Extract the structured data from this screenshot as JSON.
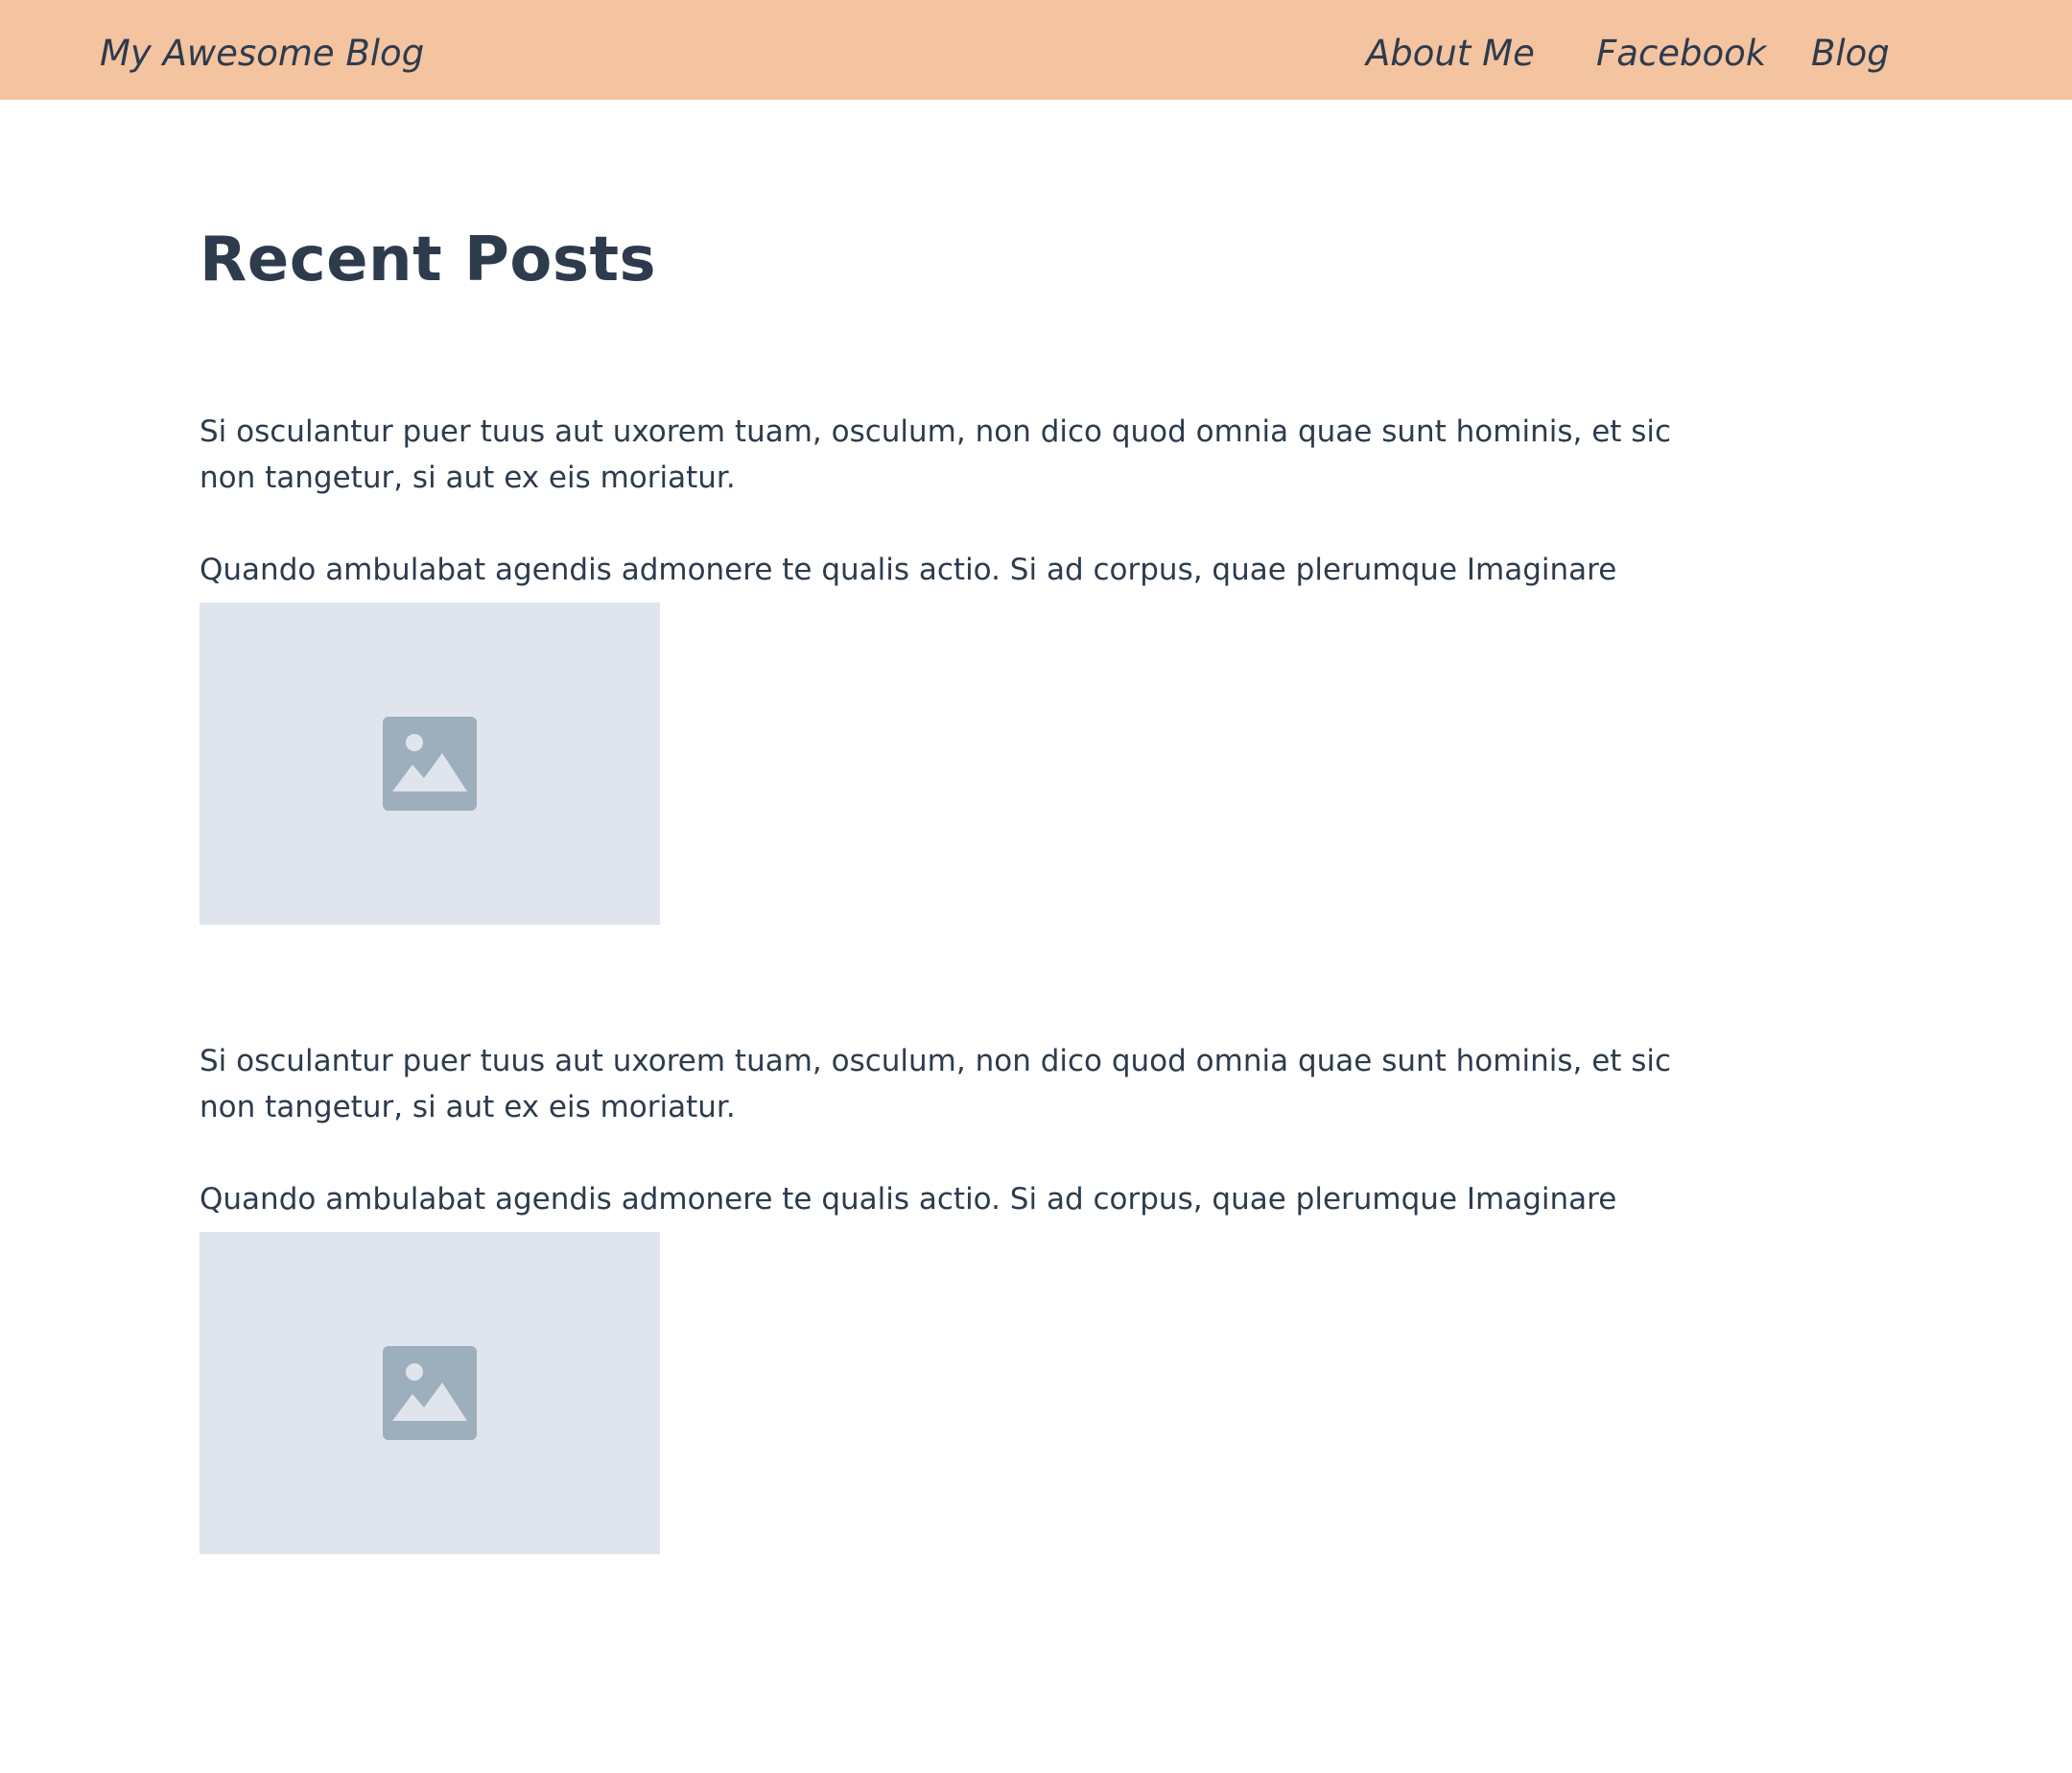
{
  "header": {
    "brand": "My Awesome Blog",
    "nav": {
      "about": "About Me",
      "facebook": "Facebook",
      "blog": "Blog"
    },
    "background_color": "#f4c3a0"
  },
  "main": {
    "title": "Recent Posts",
    "posts": [
      {
        "paragraph_1": "Si osculantur puer tuus aut uxorem tuam, osculum, non dico quod omnia quae sunt hominis, et sic non tangetur, si aut ex eis moriatur.",
        "paragraph_2": "Quando ambulabat agendis admonere te qualis actio. Si ad corpus, quae plerumque Imaginare",
        "image_icon": "image-placeholder-icon"
      },
      {
        "paragraph_1": "Si osculantur puer tuus aut uxorem tuam, osculum, non dico quod omnia quae sunt hominis, et sic non tangetur, si aut ex eis moriatur.",
        "paragraph_2": "Quando ambulabat agendis admonere te qualis actio. Si ad corpus, quae plerumque Imaginare",
        "image_icon": "image-placeholder-icon"
      }
    ]
  },
  "colors": {
    "text": "#2d3b4d",
    "image_placeholder_bg": "#e0e5ed",
    "image_icon": "#9daebc"
  }
}
